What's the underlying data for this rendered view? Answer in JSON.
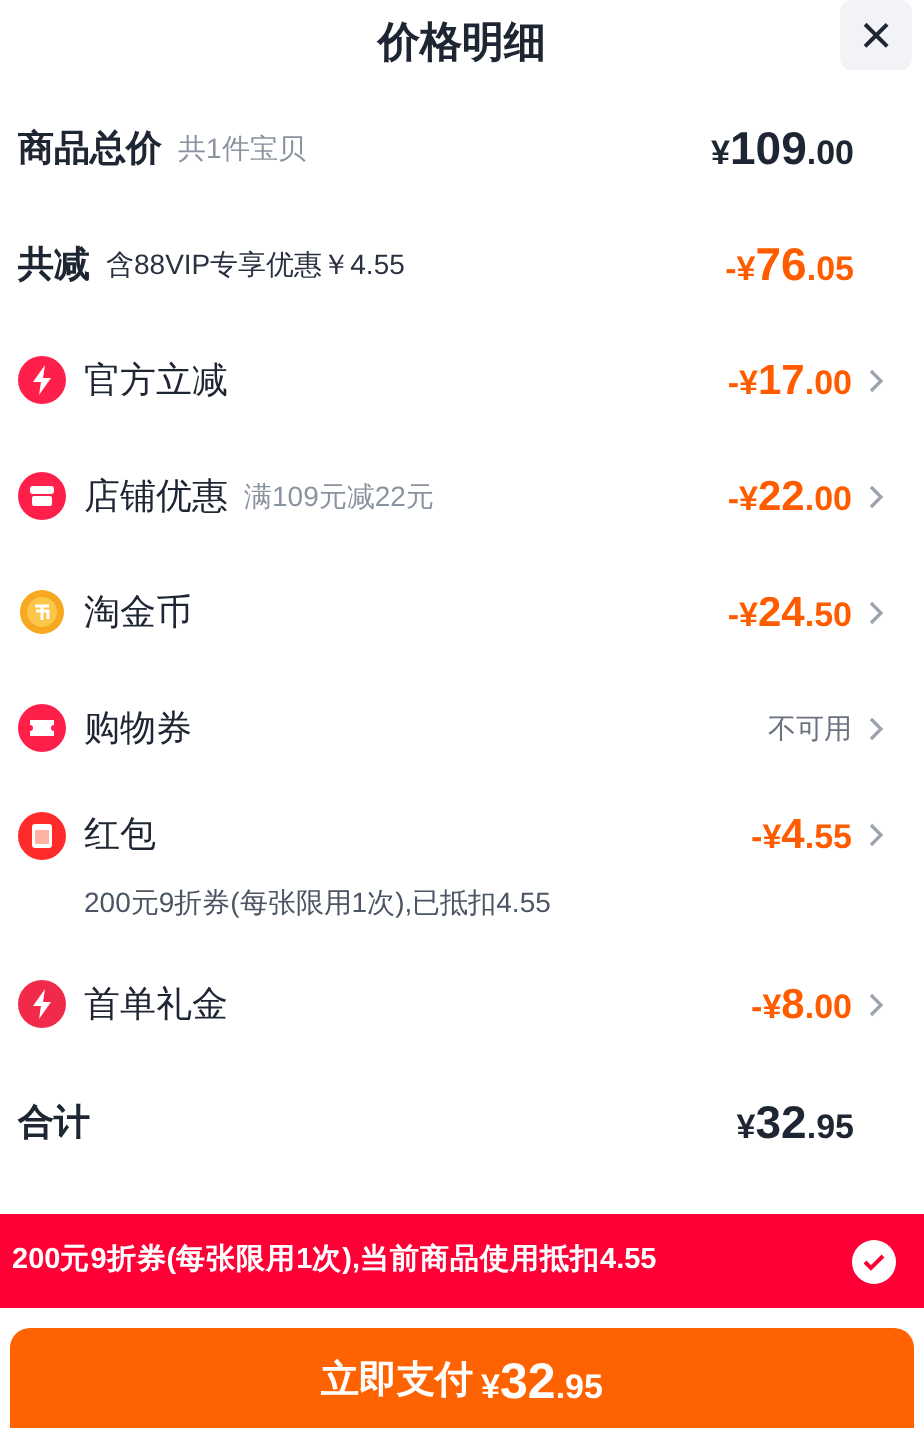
{
  "header": {
    "title": "价格明细",
    "close": "×"
  },
  "total": {
    "label": "商品总价",
    "note": "共1件宝贝",
    "amount": "¥109.00"
  },
  "savings": {
    "label": "共减",
    "note": "含88VIP专享优惠￥4.55",
    "amount": "-¥76.05"
  },
  "rows": [
    {
      "kind": "amount",
      "label": "官方立减",
      "value": "-¥17.00"
    },
    {
      "kind": "amount",
      "label": "店铺优惠",
      "note": "满109元减22元",
      "value": "-¥22.00"
    },
    {
      "kind": "amount",
      "label": "淘金币",
      "value": "-¥24.50"
    },
    {
      "kind": "status",
      "label": "购物券",
      "value": "不可用"
    },
    {
      "kind": "amount",
      "label": "红包",
      "value": "-¥4.55",
      "detail": "200元9折券(每张限用1次),已抵扣4.55"
    },
    {
      "kind": "amount",
      "label": "首单礼金",
      "value": "-¥8.00"
    }
  ],
  "sum": {
    "label": "合计",
    "amount": "¥32.95"
  },
  "banner": {
    "text": "200元9折券(每张限用1次),当前商品使用抵扣4.55",
    "checked": true
  },
  "pay": {
    "label": "立即支付",
    "amount": "¥32.95"
  }
}
